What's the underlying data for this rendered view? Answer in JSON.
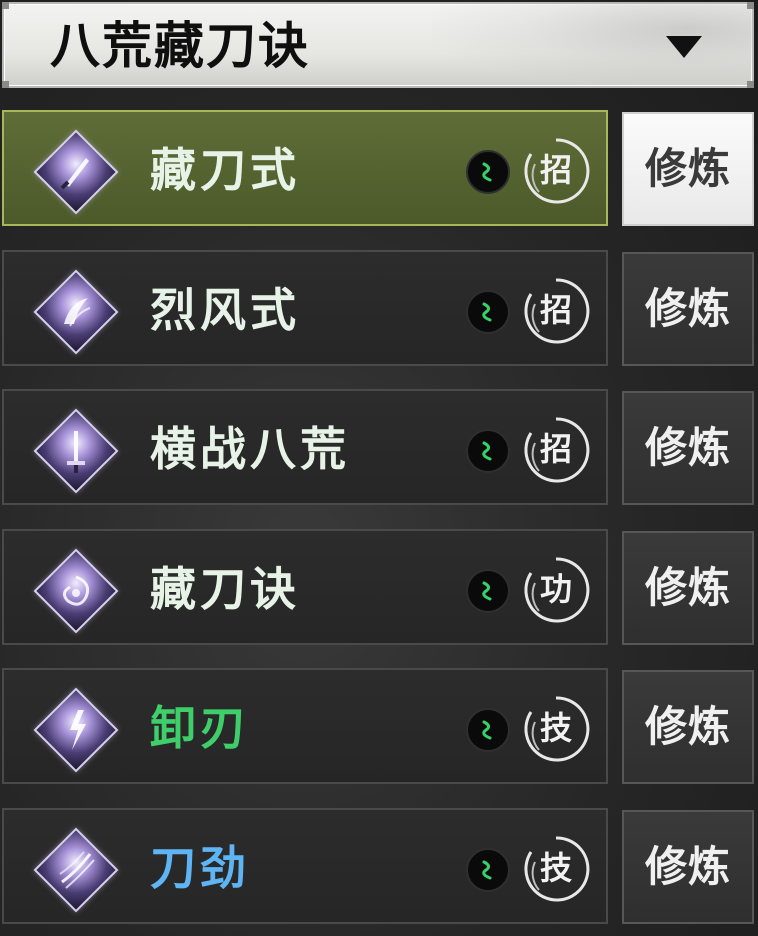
{
  "header": {
    "title": "八荒藏刀诀",
    "dropdown_icon": "chevron-down-icon"
  },
  "skills": [
    {
      "name": "藏刀式",
      "type_label": "招",
      "train_label": "修炼",
      "selected": true,
      "name_color": "#e8f3e8",
      "icon": "blade-sheath-icon"
    },
    {
      "name": "烈风式",
      "type_label": "招",
      "train_label": "修炼",
      "selected": false,
      "name_color": "#e8f3e8",
      "icon": "wind-blade-icon"
    },
    {
      "name": "横战八荒",
      "type_label": "招",
      "train_label": "修炼",
      "selected": false,
      "name_color": "#e8f3e8",
      "icon": "sword-icon"
    },
    {
      "name": "藏刀诀",
      "type_label": "功",
      "train_label": "修炼",
      "selected": false,
      "name_color": "#e8f3e8",
      "icon": "vortex-icon"
    },
    {
      "name": "卸刃",
      "type_label": "技",
      "train_label": "修炼",
      "selected": false,
      "name_color": "#3fcf6a",
      "icon": "lightning-blade-icon"
    },
    {
      "name": "刀劲",
      "type_label": "技",
      "train_label": "修炼",
      "selected": false,
      "name_color": "#5fb4f3",
      "icon": "claw-slash-icon"
    }
  ],
  "colors": {
    "selected_row": "#5f6d38",
    "selected_border": "#a7b85a",
    "green_name": "#3fcf6a",
    "blue_name": "#5fb4f3"
  }
}
